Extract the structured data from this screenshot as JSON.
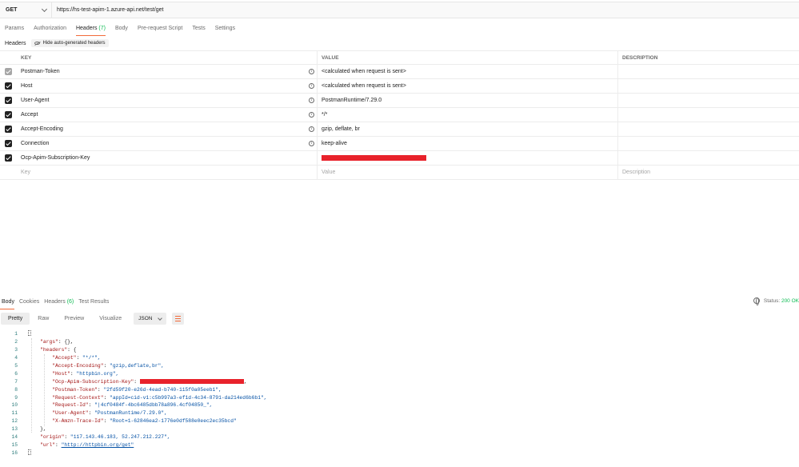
{
  "request": {
    "method": "GET",
    "url": "https://hs-test-apim-1.azure-api.net/test/get"
  },
  "request_tabs": [
    {
      "label": "Params",
      "count": ""
    },
    {
      "label": "Authorization",
      "count": ""
    },
    {
      "label": "Headers",
      "count": "(7)"
    },
    {
      "label": "Body",
      "count": ""
    },
    {
      "label": "Pre-request Script",
      "count": ""
    },
    {
      "label": "Tests",
      "count": ""
    },
    {
      "label": "Settings",
      "count": ""
    }
  ],
  "headers_section": {
    "label": "Headers",
    "hide_button": "Hide auto-generated headers"
  },
  "table": {
    "columns": {
      "key": "KEY",
      "value": "VALUE",
      "description": "DESCRIPTION"
    },
    "rows": [
      {
        "key": "Postman-Token",
        "value": "<calculated when request is sent>",
        "checked": "disabled",
        "info": true
      },
      {
        "key": "Host",
        "value": "<calculated when request is sent>",
        "checked": "checked",
        "info": true
      },
      {
        "key": "User-Agent",
        "value": "PostmanRuntime/7.29.0",
        "checked": "checked",
        "info": true
      },
      {
        "key": "Accept",
        "value": "*/*",
        "checked": "checked",
        "info": true
      },
      {
        "key": "Accept-Encoding",
        "value": "gzip, deflate, br",
        "checked": "checked",
        "info": true
      },
      {
        "key": "Connection",
        "value": "keep-alive",
        "checked": "checked",
        "info": true
      },
      {
        "key": "Ocp-Apim-Subscription-Key",
        "value": "",
        "checked": "checked",
        "info": false,
        "redacted": true
      }
    ],
    "new_row": {
      "key": "Key",
      "value": "Value",
      "description": "Description"
    }
  },
  "response_tabs": [
    {
      "label": "Body",
      "count": ""
    },
    {
      "label": "Cookies",
      "count": ""
    },
    {
      "label": "Headers",
      "count": "(6)"
    },
    {
      "label": "Test Results",
      "count": ""
    }
  ],
  "status": {
    "label": "Status:",
    "value": "200 OK",
    "icon": "globe-icon",
    "color": "#0cbb52"
  },
  "view_modes": [
    "Pretty",
    "Raw",
    "Preview",
    "Visualize"
  ],
  "format": "JSON",
  "code_lines": [
    {
      "n": "1"
    },
    {
      "n": "2"
    },
    {
      "n": "3"
    },
    {
      "n": "4"
    },
    {
      "n": "5"
    },
    {
      "n": "6"
    },
    {
      "n": "7"
    },
    {
      "n": "8"
    },
    {
      "n": "9"
    },
    {
      "n": "10"
    },
    {
      "n": "11"
    },
    {
      "n": "12"
    },
    {
      "n": "13"
    },
    {
      "n": "14"
    },
    {
      "n": "15"
    },
    {
      "n": "16"
    }
  ],
  "body": {
    "args_key": "\"args\"",
    "args_val": "{},",
    "headers_key": "\"headers\"",
    "headers_open": "{",
    "accept_key": "\"Accept\"",
    "accept_val": "\"*/*\",",
    "enc_key": "\"Accept-Encoding\"",
    "enc_val": "\"gzip,deflate,br\",",
    "host_key": "\"Host\"",
    "host_val": "\"httpbin.org\",",
    "ocp_key": "\"Ocp-Apim-Subscription-Key\"",
    "ocp_tail": ",",
    "pt_key": "\"Postman-Token\"",
    "pt_val": "\"2fd59f20-e26d-4ead-b740-115f0a05eeb1\",",
    "rc_key": "\"Request-Context\"",
    "rc_val": "\"appId=cid-v1:c5b997a3-ef1d-4c34-8791-da214ed6b6b1\",",
    "rid_key": "\"Request-Id\"",
    "rid_val": "\"|4cf0484f-4bc6485dbb78a896.4cf04850_\",",
    "ua_key": "\"User-Agent\"",
    "ua_val": "\"PostmanRuntime/7.29.0\",",
    "amzn_key": "\"X-Amzn-Trace-Id\"",
    "amzn_val": "\"Root=1-62846ea2-1776e0df588e0eec2ec35bcd\"",
    "headers_close": "},",
    "origin_key": "\"origin\"",
    "origin_val": "\"117.143.46.183, 52.247.212.227\",",
    "url_key": "\"url\"",
    "url_val": "\"http://httpbin.org/get\""
  }
}
